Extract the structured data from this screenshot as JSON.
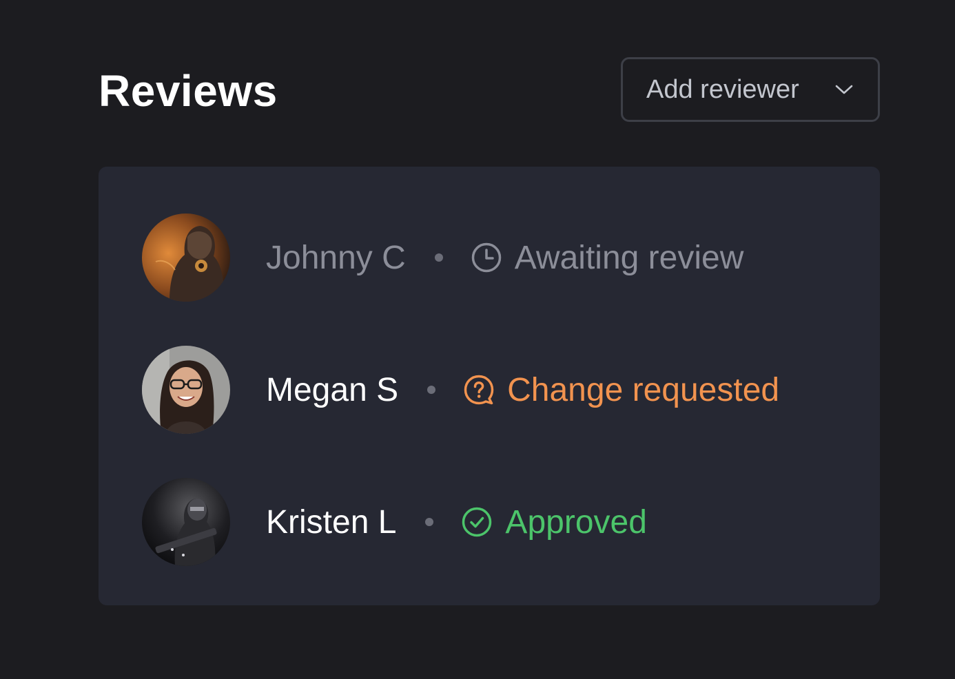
{
  "header": {
    "title": "Reviews",
    "add_reviewer_label": "Add reviewer"
  },
  "reviewers": [
    {
      "name": "Johnny C",
      "status": "Awaiting review",
      "status_icon": "clock-icon",
      "status_color": "#8c8e99"
    },
    {
      "name": "Megan S",
      "status": "Change requested",
      "status_icon": "question-bubble-icon",
      "status_color": "#f2934f"
    },
    {
      "name": "Kristen L",
      "status": "Approved",
      "status_icon": "check-circle-icon",
      "status_color": "#4cc46a"
    }
  ],
  "colors": {
    "background": "#1c1c20",
    "card": "#262833",
    "awaiting": "#8c8e99",
    "change_requested": "#f2934f",
    "approved": "#4cc46a"
  }
}
